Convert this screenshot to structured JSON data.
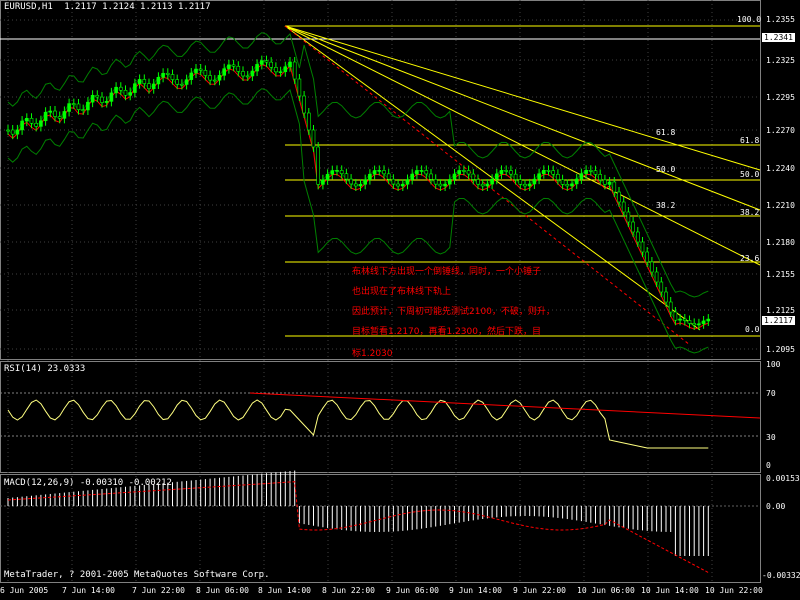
{
  "header": {
    "symbol": "EURUSD,H1",
    "ohlc": "1.2117 1.2124 1.2113 1.2117"
  },
  "price_axis": {
    "ticks": [
      "1.2355",
      "1.2325",
      "1.2295",
      "1.2270",
      "1.2240",
      "1.2210",
      "1.2180",
      "1.2155",
      "1.2125",
      "1.2095"
    ],
    "current_price": "1.2117",
    "marker_price": "1.2341"
  },
  "fib_levels": [
    "100.0",
    "61.8",
    "50.0",
    "38.2",
    "23.6",
    "0.0"
  ],
  "annotation": [
    "布林线下方出现一个倒锤线，同时，一个小锤子",
    "也出现在了布林线下轨上",
    "因此预计，下周初可能先测试2100，不破，则升，",
    "目标暂看1.2170，再看1.2300，然后下跌，目",
    "标1.2030"
  ],
  "rsi": {
    "title": "RSI(14) 23.0333",
    "ticks": [
      "100",
      "70",
      "30",
      "0"
    ]
  },
  "macd": {
    "title": "MACD(12,26,9) -0.00310 -0.00212",
    "ticks": [
      "0.00153",
      "0.00",
      "-0.00332"
    ]
  },
  "copyright": "MetaTrader, ? 2001-2005 MetaQuotes Software Corp.",
  "time_axis": [
    "6 Jun 2005",
    "7 Jun 14:00",
    "7 Jun 22:00",
    "8 Jun 06:00",
    "8 Jun 14:00",
    "8 Jun 22:00",
    "9 Jun 06:00",
    "9 Jun 14:00",
    "9 Jun 22:00",
    "10 Jun 06:00",
    "10 Jun 14:00",
    "10 Jun 22:00"
  ],
  "colors": {
    "bull": "#00ff00",
    "bear": "#000000",
    "bollinger": "#008000",
    "ma": "#ff0000",
    "fib": "#ffff00",
    "grid": "#808080"
  }
}
